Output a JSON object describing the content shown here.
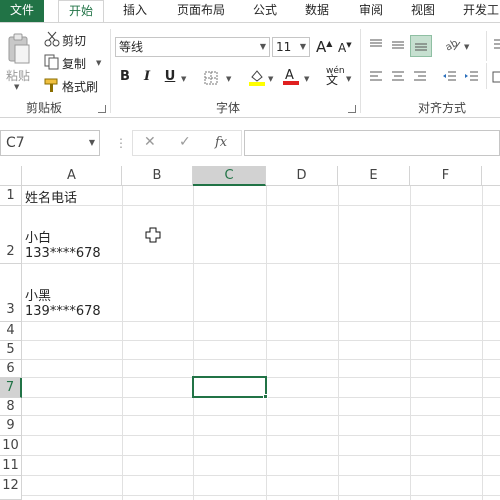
{
  "tabs": [
    "文件",
    "开始",
    "插入",
    "页面布局",
    "公式",
    "数据",
    "审阅",
    "视图",
    "开发工"
  ],
  "active_tab": "开始",
  "ribbon": {
    "clipboard": {
      "paste_label": "粘贴",
      "cut_label": "剪切",
      "copy_label": "复制",
      "format_painter_label": "格式刷",
      "group_label": "剪贴板"
    },
    "font": {
      "font_name": "等线",
      "font_size": "11",
      "bold": "B",
      "italic": "I",
      "underline": "U",
      "phonetic": "wén",
      "group_label": "字体"
    },
    "alignment": {
      "group_label": "对齐方式"
    }
  },
  "formula_bar": {
    "name_box": "C7",
    "cancel_icon": "✕",
    "enter_icon": "✓",
    "fx_label": "fx",
    "formula": ""
  },
  "grid": {
    "columns": [
      "A",
      "B",
      "C",
      "D",
      "E",
      "F"
    ],
    "selected_column": "C",
    "rows": [
      "1",
      "2",
      "3",
      "4",
      "5",
      "6",
      "7",
      "8",
      "9",
      "10",
      "11",
      "12"
    ],
    "selected_row": "7",
    "cells": {
      "A1": "姓名电话",
      "A2_line1": "小白",
      "A2_line2": "133****678",
      "A3_line1": "小黑",
      "A3_line2": "139****678"
    },
    "selected_cell": "C7"
  },
  "colors": {
    "accent": "#217346",
    "header_selected": "#d2d2d2",
    "grid_line": "#e1e1e1"
  }
}
